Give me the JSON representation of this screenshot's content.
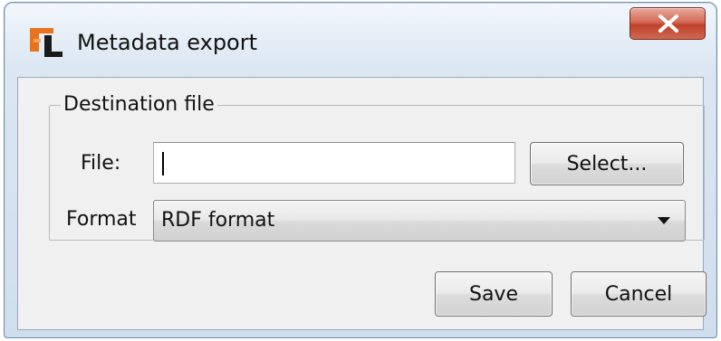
{
  "window": {
    "title": "Metadata export",
    "icon": "jabref-app-icon",
    "close_icon": "close-icon",
    "accent": "#c0402a",
    "app_icon_color": "#e8731c"
  },
  "destination": {
    "legend": "Destination file",
    "file_label": "File:",
    "file_value": "",
    "select_label": "Select..."
  },
  "format": {
    "label": "Format",
    "selected": "RDF format",
    "arrow_icon": "chevron-down-icon"
  },
  "actions": {
    "save_label": "Save",
    "cancel_label": "Cancel"
  }
}
